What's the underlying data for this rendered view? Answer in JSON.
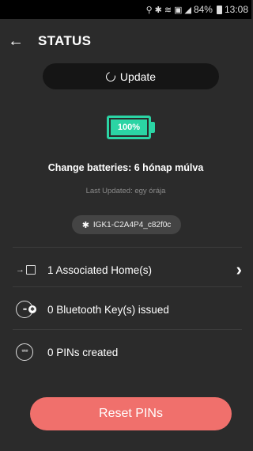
{
  "status_bar": {
    "battery_percent": "84%",
    "time": "13:08"
  },
  "app_bar": {
    "title": "STATUS"
  },
  "update_button": {
    "label": "Update"
  },
  "battery": {
    "level_percent": 100,
    "label": "100%",
    "color": "#2bd4a4"
  },
  "change_batteries": "Change batteries: 6 hónap múlva",
  "last_updated": "Last Updated: egy órája",
  "device": {
    "id": "IGK1-C2A4P4_c82f0c"
  },
  "rows": [
    {
      "label": "1 Associated Home(s)",
      "icon": "home-icon",
      "chevron": true
    },
    {
      "label": "0 Bluetooth Key(s) issued",
      "icon": "bluetooth-key-icon"
    },
    {
      "label": "0 PINs created",
      "icon": "pin-icon"
    }
  ],
  "reset_button": {
    "label": "Reset PINs",
    "color": "#f0706c"
  }
}
